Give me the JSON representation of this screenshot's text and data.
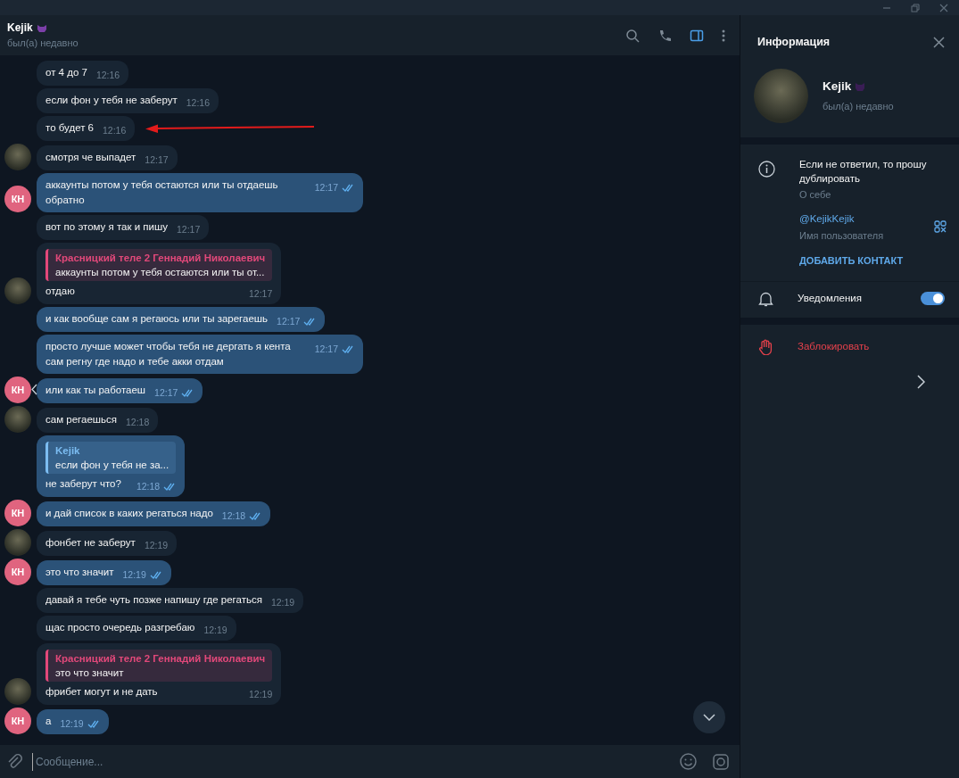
{
  "chat_header": {
    "name": "Kejik",
    "status": "был(а) недавно",
    "info_panel_button": {
      "selected": true
    }
  },
  "messages": [
    {
      "kind": "incoming",
      "text": "от 4 до 7",
      "time": "12:16"
    },
    {
      "kind": "incoming",
      "text": "если фон у тебя не заберут",
      "time": "12:16"
    },
    {
      "kind": "incoming",
      "text": "то будет 6",
      "time": "12:16",
      "annotation_arrow": true
    },
    {
      "kind": "incoming",
      "text": "смотря че выпадет",
      "time": "12:17",
      "avatar": {
        "kind": "photo"
      }
    },
    {
      "kind": "outgoing",
      "text": "аккаунты потом у тебя остаются или ты отдаешь обратно",
      "time": "12:17",
      "read": true,
      "avatar": {
        "kind": "initials",
        "text": "КН",
        "color": "#e0647f"
      }
    },
    {
      "kind": "incoming",
      "text": "вот по этому я так и пишу",
      "time": "12:17"
    },
    {
      "kind": "incoming",
      "text": "отдаю",
      "time": "12:17",
      "reply": {
        "name": "Красницкий теле 2 Геннадий Николаевич",
        "text": "аккаунты потом у тебя остаются или ты от...",
        "color": "#e2487a"
      },
      "avatar": {
        "kind": "photo"
      }
    },
    {
      "kind": "outgoing",
      "text": "и как вообще сам я регаюсь или ты зарегаешь",
      "time": "12:17",
      "read": true
    },
    {
      "kind": "outgoing",
      "text": "просто лучше может чтобы тебя не дергать я кента сам регну где надо и тебе акки отдам",
      "time": "12:17",
      "read": true
    },
    {
      "kind": "outgoing",
      "text": "или как ты работаеш",
      "time": "12:17",
      "read": true,
      "chevron": true,
      "avatar": {
        "kind": "initials",
        "text": "КН",
        "color": "#e0647f"
      }
    },
    {
      "kind": "incoming",
      "text": "сам регаешься",
      "time": "12:18",
      "avatar": {
        "kind": "photo"
      }
    },
    {
      "kind": "outgoing",
      "text": "не заберут что?",
      "time": "12:18",
      "read": true,
      "reply": {
        "name": "Kejik",
        "text": "если фон у тебя не за...",
        "color": "#7cbdf2"
      }
    },
    {
      "kind": "outgoing",
      "text": "и дай список в каких регаться надо",
      "time": "12:18",
      "read": true,
      "avatar": {
        "kind": "initials",
        "text": "КН",
        "color": "#e0647f"
      }
    },
    {
      "kind": "incoming",
      "text": "фонбет не заберут",
      "time": "12:19",
      "avatar": {
        "kind": "photo"
      }
    },
    {
      "kind": "outgoing",
      "text": "это что значит",
      "time": "12:19",
      "read": true,
      "avatar": {
        "kind": "initials",
        "text": "КН",
        "color": "#e0647f"
      }
    },
    {
      "kind": "incoming",
      "text": "давай я тебе чуть позже напишу где регаться",
      "time": "12:19"
    },
    {
      "kind": "incoming",
      "text": "щас просто очередь разгребаю",
      "time": "12:19"
    },
    {
      "kind": "incoming",
      "text": "фрибет могут и не дать",
      "time": "12:19",
      "reply": {
        "name": "Красницкий теле 2 Геннадий Николаевич",
        "text": "это что значит",
        "color": "#e2487a"
      },
      "avatar": {
        "kind": "photo"
      }
    },
    {
      "kind": "outgoing",
      "text": "а",
      "time": "12:19",
      "read": true,
      "avatar": {
        "kind": "initials",
        "text": "КН",
        "color": "#e0647f"
      }
    }
  ],
  "composer": {
    "placeholder": "Сообщение..."
  },
  "info_panel": {
    "title": "Информация",
    "name": "Kejik",
    "status": "был(а) недавно",
    "bio": "Если не ответил, то прошу дублировать",
    "bio_label": "О себе",
    "username": "@KejikKejik",
    "username_label": "Имя пользователя",
    "add_contact": "ДОБАВИТЬ КОНТАКТ",
    "notifications": {
      "label": "Уведомления",
      "on": true
    },
    "block": "Заблокировать"
  }
}
